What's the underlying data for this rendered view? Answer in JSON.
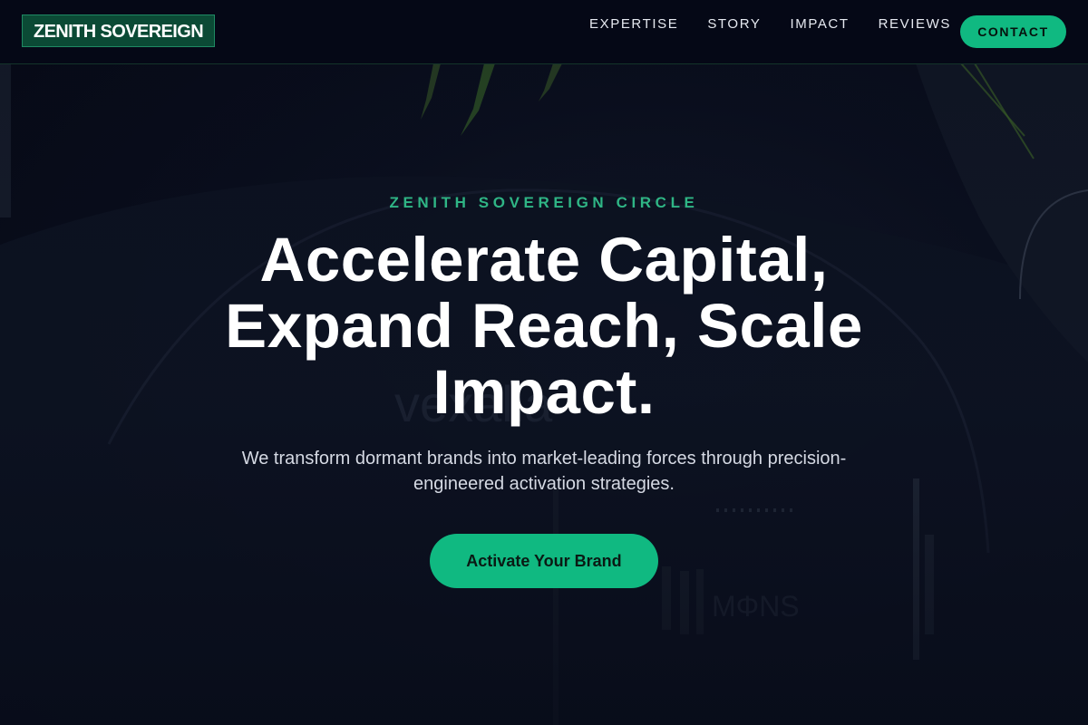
{
  "header": {
    "logo_text": "ZENITH SOVEREIGN",
    "nav": [
      {
        "label": "EXPERTISE"
      },
      {
        "label": "STORY"
      },
      {
        "label": "IMPACT"
      },
      {
        "label": "REVIEWS"
      }
    ],
    "contact_label": "CONTACT"
  },
  "hero": {
    "eyebrow": "ZENITH SOVEREIGN CIRCLE",
    "headline_line1": "Accelerate Capital,",
    "headline_line2": "Expand Reach, Scale",
    "headline_line3": "Impact.",
    "subtext_line1": "We transform dormant brands into market-leading forces through precision-",
    "subtext_line2": "engineered activation strategies.",
    "cta_label": "Activate Your Brand"
  },
  "colors": {
    "accent": "#10b981",
    "background": "#070b18",
    "logo_bg": "#0b4a35",
    "eyebrow": "#2fb585"
  }
}
